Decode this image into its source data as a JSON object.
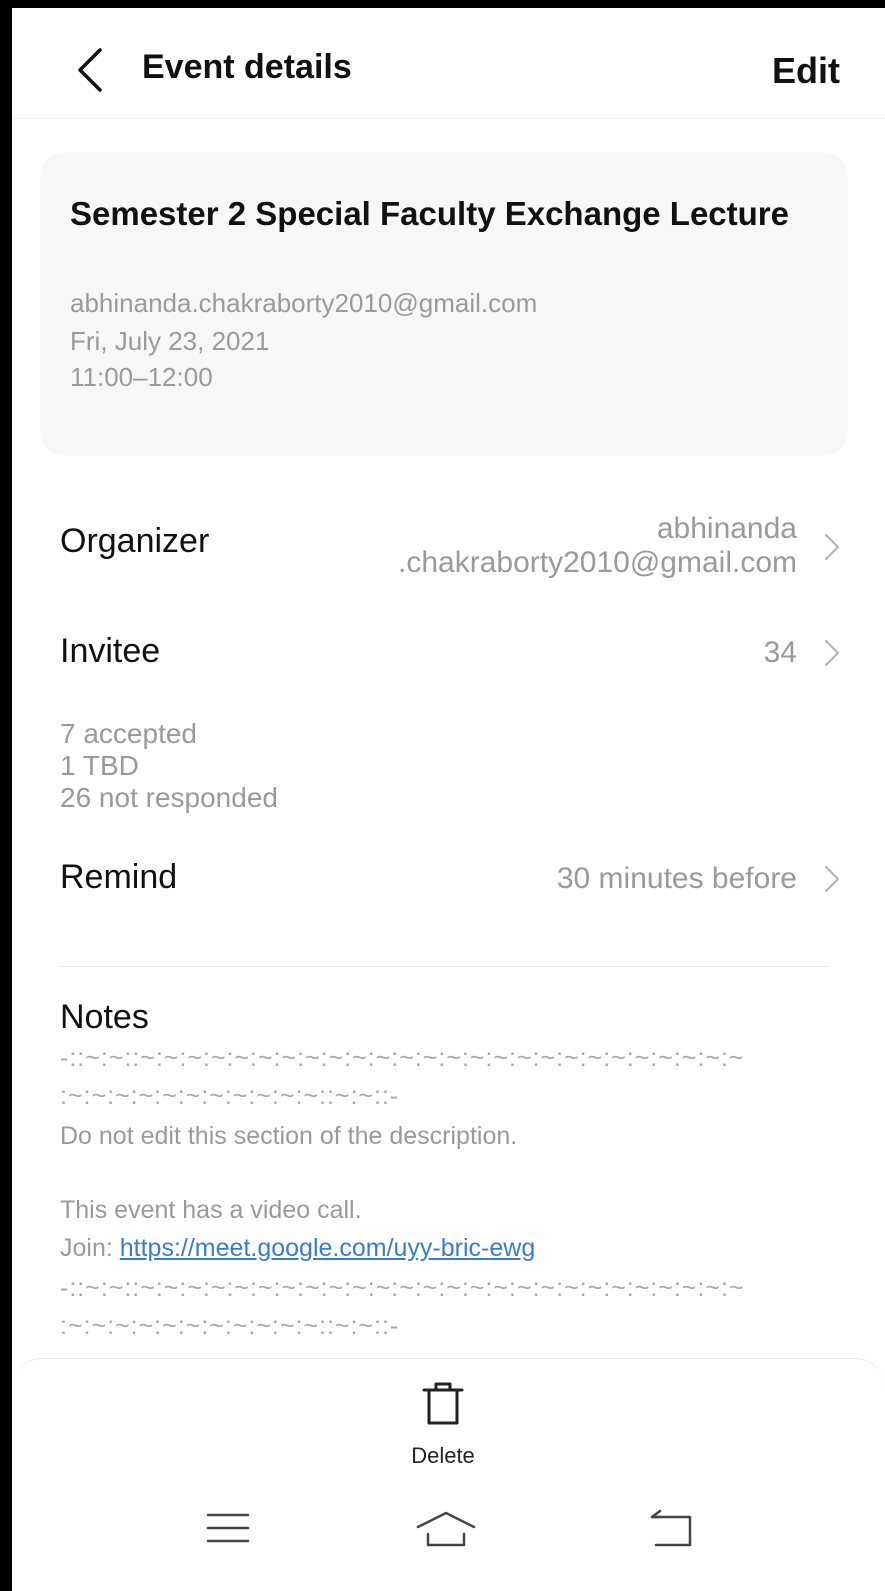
{
  "header": {
    "title": "Event details",
    "edit_label": "Edit"
  },
  "event": {
    "title": "Semester 2 Special Faculty Exchange Lecture",
    "account": "abhinanda.chakraborty2010@gmail.com",
    "date": "Fri, July 23, 2021",
    "time": "11:00–12:00"
  },
  "organizer": {
    "label": "Organizer",
    "value_line1": "abhinanda",
    "value_line2": ".chakraborty2010@gmail.com"
  },
  "invitee": {
    "label": "Invitee",
    "count": "34",
    "accepted": "7 accepted",
    "tbd": "1 TBD",
    "not_responded": "26 not responded"
  },
  "remind": {
    "label": "Remind",
    "value": "30 minutes before"
  },
  "notes": {
    "title": "Notes",
    "separator_line1": "-::~:~::~:~:~:~:~:~:~:~:~:~:~:~:~:~:~:~:~:~:~:~:~:~:~:~:~:~",
    "separator_line2": ":~:~:~:~:~:~:~:~:~:~:~::~:~::-",
    "warning": "Do not edit this section of the description.",
    "video_call": "This event has a video call.",
    "join_prefix": "Join: ",
    "join_link": "https://meet.google.com/uyy-bric-ewg",
    "separator_line3": "-::~:~::~:~:~:~:~:~:~:~:~:~:~:~:~:~:~:~:~:~:~:~:~:~:~:~:~:~",
    "separator_line4": ":~:~:~:~:~:~:~:~:~:~:~::~:~::-"
  },
  "bottom": {
    "delete_label": "Delete"
  },
  "icons": {
    "back": "chevron-left-icon",
    "chevron": "chevron-right-icon",
    "delete": "trash-icon",
    "menu": "menu-icon",
    "home": "home-icon",
    "return": "back-icon"
  },
  "colors": {
    "link": "#3a7bd5",
    "secondary_text": "#9a9a9a",
    "card_bg": "#f7f7f7"
  }
}
